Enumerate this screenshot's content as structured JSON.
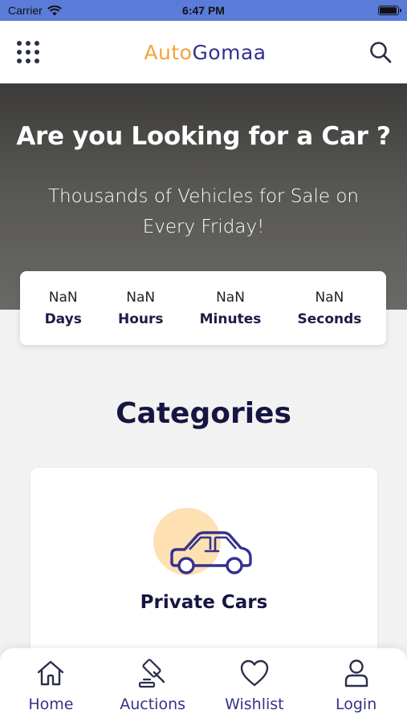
{
  "status_bar": {
    "carrier": "Carrier",
    "time": "6:47 PM",
    "battery_level": 0.95
  },
  "header": {
    "logo_part1": "Auto",
    "logo_part2": "Gomaa"
  },
  "hero": {
    "title": "Are you Looking for a Car ?",
    "subtitle": "Thousands of Vehicles for Sale on Every Friday!"
  },
  "countdown": {
    "items": [
      {
        "value": "NaN",
        "label": "Days"
      },
      {
        "value": "NaN",
        "label": "Hours"
      },
      {
        "value": "NaN",
        "label": "Minutes"
      },
      {
        "value": "NaN",
        "label": "Seconds"
      }
    ]
  },
  "categories": {
    "title": "Categories",
    "items": [
      {
        "label": "Private Cars",
        "icon": "car-icon"
      }
    ]
  },
  "bottom_nav": {
    "items": [
      {
        "label": "Home",
        "icon": "home-icon"
      },
      {
        "label": "Auctions",
        "icon": "gavel-icon"
      },
      {
        "label": "Wishlist",
        "icon": "heart-icon"
      },
      {
        "label": "Login",
        "icon": "user-icon"
      }
    ]
  },
  "colors": {
    "status_bar": "#5b7bd8",
    "brand_orange": "#f3a43a",
    "brand_navy": "#35318e",
    "heading": "#171640"
  }
}
